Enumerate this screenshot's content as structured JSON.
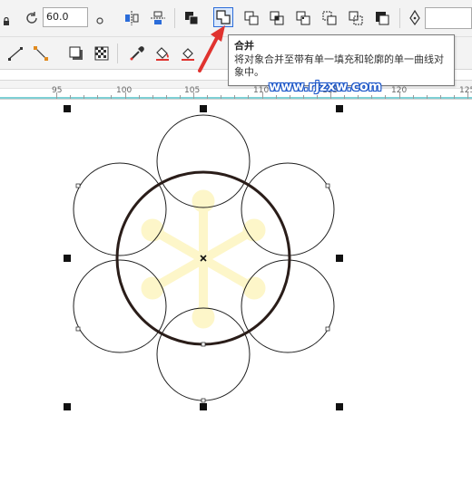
{
  "toolbar": {
    "angle_value": "60.0",
    "buttons": [
      "mirror-horizontal",
      "mirror-vertical",
      "combine-group",
      "weld-merge",
      "trim",
      "intersect",
      "simplify",
      "front-minus-back",
      "back-minus-front",
      "create-boundary",
      "pen-outline"
    ],
    "active_button": "weld-merge"
  },
  "tooltip": {
    "title": "合并",
    "body": "将对象合并至带有单一填充和轮廓的单一曲线对象中。"
  },
  "watermark": "www.rjzxw.com",
  "ruler": {
    "labels": [
      "95",
      "100",
      "105",
      "110",
      "115",
      "120",
      "125"
    ]
  },
  "colors": {
    "accent": "#2b6cd9",
    "arrow": "#e0332f",
    "ghost_fill": "#fdf6c9",
    "stroke": "#1e1e1e"
  }
}
